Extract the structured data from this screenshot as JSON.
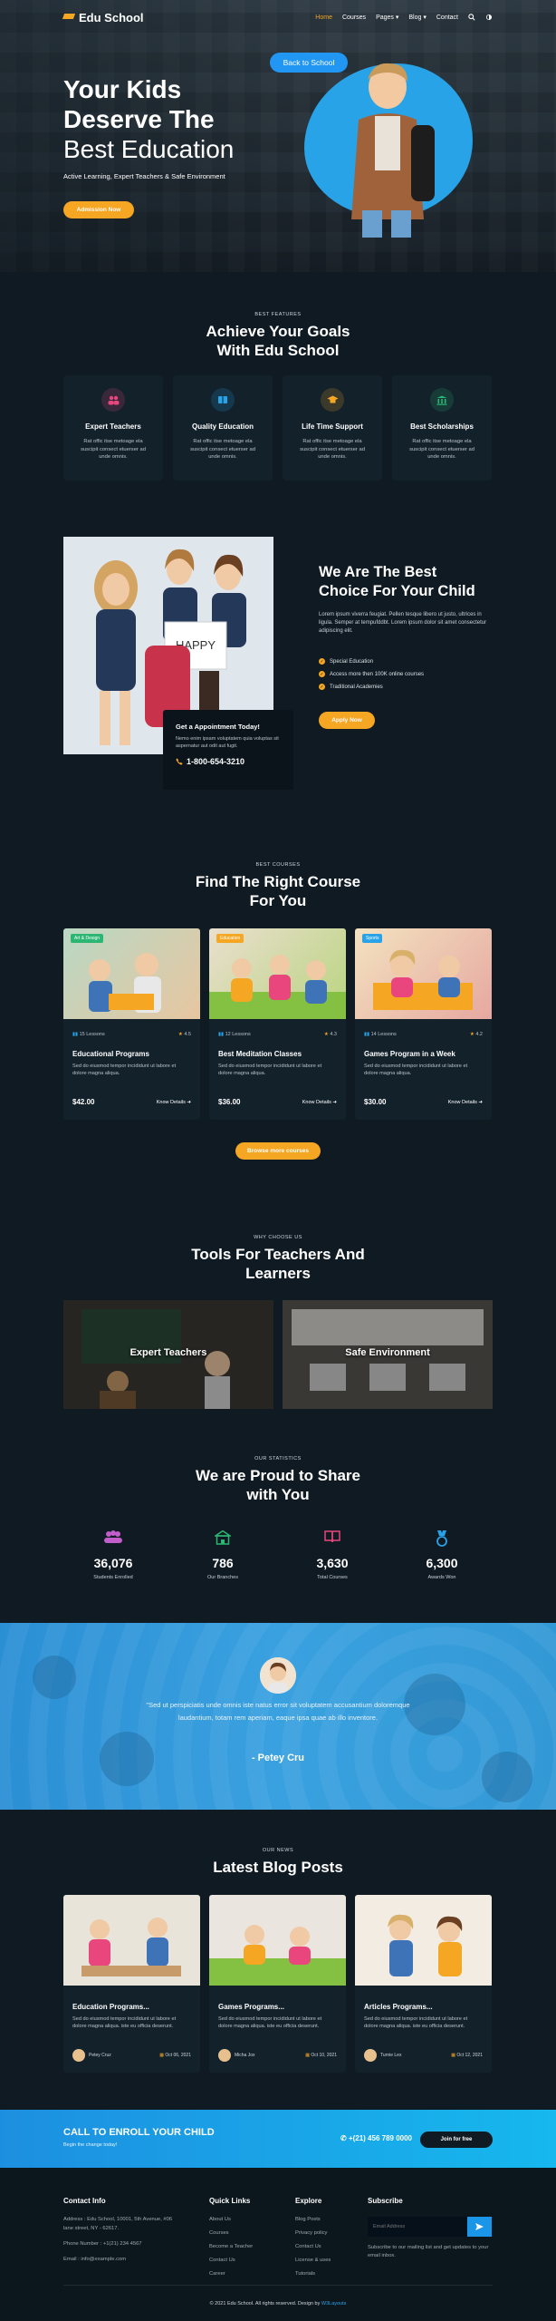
{
  "nav": {
    "brand": "Edu School",
    "items": [
      "Home",
      "Courses",
      "Pages",
      "Blog",
      "Contact"
    ],
    "active": "Home"
  },
  "hero": {
    "title_line1": "Your Kids",
    "title_line2": "Deserve The",
    "title_line3": "Best Education",
    "subtitle": "Active Learning, Expert Teachers & Safe Environment",
    "button": "Admission Now",
    "badge": "Back to School"
  },
  "features": {
    "label": "BEST FEATURES",
    "title_line1": "Achieve Your Goals",
    "title_line2": "With Edu School",
    "items": [
      {
        "title": "Expert Teachers",
        "desc": "Rat offic itse metoage ela suscipit consect etuerser ad unde omnis.",
        "icon": "users-icon",
        "color": "#e8467c"
      },
      {
        "title": "Quality Education",
        "desc": "Rat offic itse metoage ela suscipit consect etuerser ad unde omnis.",
        "icon": "book-icon",
        "color": "#29a3e8"
      },
      {
        "title": "Life Time Support",
        "desc": "Rat offic itse metoage ela suscipit consect etuerser ad unde omnis.",
        "icon": "graduation-cap-icon",
        "color": "#f5a623"
      },
      {
        "title": "Best Scholarships",
        "desc": "Rat offic itse metoage ela suscipit consect etuerser ad unde omnis.",
        "icon": "bank-icon",
        "color": "#2bb673"
      }
    ]
  },
  "about": {
    "title_line1": "We Are The Best",
    "title_line2": "Choice For Your Child",
    "desc": "Lorem ipsum viverra feugiat. Pellen tesque libero ut justo, ultrices in ligula. Semper at tempufddbt. Lorem ipsum dolor sit amet consectetur adipiscing elit.",
    "checks": [
      "Special Education",
      "Access more then 100K online courses",
      "Traditional Academies"
    ],
    "button": "Apply Now",
    "appointment": {
      "title": "Get a Appointment Today!",
      "desc": "Nemo enim ipsam voluptatem quia voluptas sit aspernatur aut odit aut fugit.",
      "phone": "1-800-654-3210"
    },
    "sign_text": "HAPPY"
  },
  "courses": {
    "label": "BEST COURSES",
    "title_line1": "Find The Right Course",
    "title_line2": "For You",
    "items": [
      {
        "tag": "Art & Design",
        "tag_color": "#2bb673",
        "lessons": "15 Lessons",
        "rating": "4.5",
        "title": "Educational Programs",
        "desc": "Sed do eiusmod tempor incididunt ut labore et dolore magna aliqua.",
        "price": "$42.00",
        "more": "Know Details"
      },
      {
        "tag": "Education",
        "tag_color": "#f5a623",
        "lessons": "12 Lessons",
        "rating": "4.3",
        "title": "Best Meditation Classes",
        "desc": "Sed do eiusmod tempor incididunt ut labore et dolore magna aliqua.",
        "price": "$36.00",
        "more": "Know Details"
      },
      {
        "tag": "Sports",
        "tag_color": "#29a3e8",
        "lessons": "14 Lessons",
        "rating": "4.2",
        "title": "Games Program in a Week",
        "desc": "Sed do eiusmod tempor incididunt ut labore et dolore magna aliqua.",
        "price": "$30.00",
        "more": "Know Details"
      }
    ],
    "button": "Browse more courses"
  },
  "tools": {
    "label": "WHY CHOOSE US",
    "title_line1": "Tools For Teachers And",
    "title_line2": "Learners",
    "items": [
      "Expert Teachers",
      "Safe Environment"
    ]
  },
  "stats": {
    "label": "OUR STATISTICS",
    "title_line1": "We are Proud to Share",
    "title_line2": "with You",
    "items": [
      {
        "value": "36,076",
        "label": "Students Enrolled",
        "icon": "users-icon",
        "color": "#c25ec9"
      },
      {
        "value": "786",
        "label": "Our Branches",
        "icon": "school-icon",
        "color": "#2bb673"
      },
      {
        "value": "3,630",
        "label": "Total Courses",
        "icon": "open-book-icon",
        "color": "#e8467c"
      },
      {
        "value": "6,300",
        "label": "Awards Won",
        "icon": "medal-icon",
        "color": "#29a3e8"
      }
    ]
  },
  "testimonial": {
    "quote": "\"Sed ut perspiciatis unde omnis iste natus error sit voluptatem accusantium doloremque laudantium, totam rem aperiam, eaque ipsa quae ab illo inventore.",
    "name": "- Petey Cru"
  },
  "blog": {
    "label": "OUR NEWS",
    "title": "Latest Blog Posts",
    "items": [
      {
        "title": "Education Programs...",
        "desc": "Sed do eiusmod tempor incididunt ut labore et dolore magna aliqua. iste eu officia deserunt.",
        "author": "Petey Cruz",
        "date": "Oct 06, 2021"
      },
      {
        "title": "Games Programs...",
        "desc": "Sed do eiusmod tempor incididunt ut labore et dolore magna aliqua. iste eu officia deserunt.",
        "author": "Micha Jox",
        "date": "Oct 10, 2021"
      },
      {
        "title": "Articles Programs...",
        "desc": "Sed do eiusmod tempor incididunt ut labore et dolore magna aliqua. iste eu officia deserunt.",
        "author": "Turnie Lex",
        "date": "Oct 12, 2021"
      }
    ]
  },
  "cta": {
    "title": "CALL TO ENROLL YOUR CHILD",
    "subtitle": "Begin the change today!",
    "phone": "+(21) 456 789 0000",
    "button": "Join for free"
  },
  "footer": {
    "contact_title": "Contact Info",
    "address": "Address : Edu School, 10001, 5th Avenue, #06",
    "address2": "lane street, NY - 62617.",
    "phone": "Phone Number : +1(21) 234 4567",
    "email": "Email : info@example.com",
    "links_title": "Quick Links",
    "links": [
      "About Us",
      "Courses",
      "Become a Teacher",
      "Contact Us",
      "Career"
    ],
    "explore_title": "Explore",
    "explore": [
      "Blog Posts",
      "Privacy policy",
      "Contact Us",
      "License & uses",
      "Tutorials"
    ],
    "subscribe_title": "Subscribe",
    "email_placeholder": "Email Address",
    "subscribe_text": "Subscribe to our mailing list and get updates to your email inbox.",
    "copyright": "© 2021 Edu School. All rights reserved. Design by",
    "designer": "W3Layouts"
  }
}
